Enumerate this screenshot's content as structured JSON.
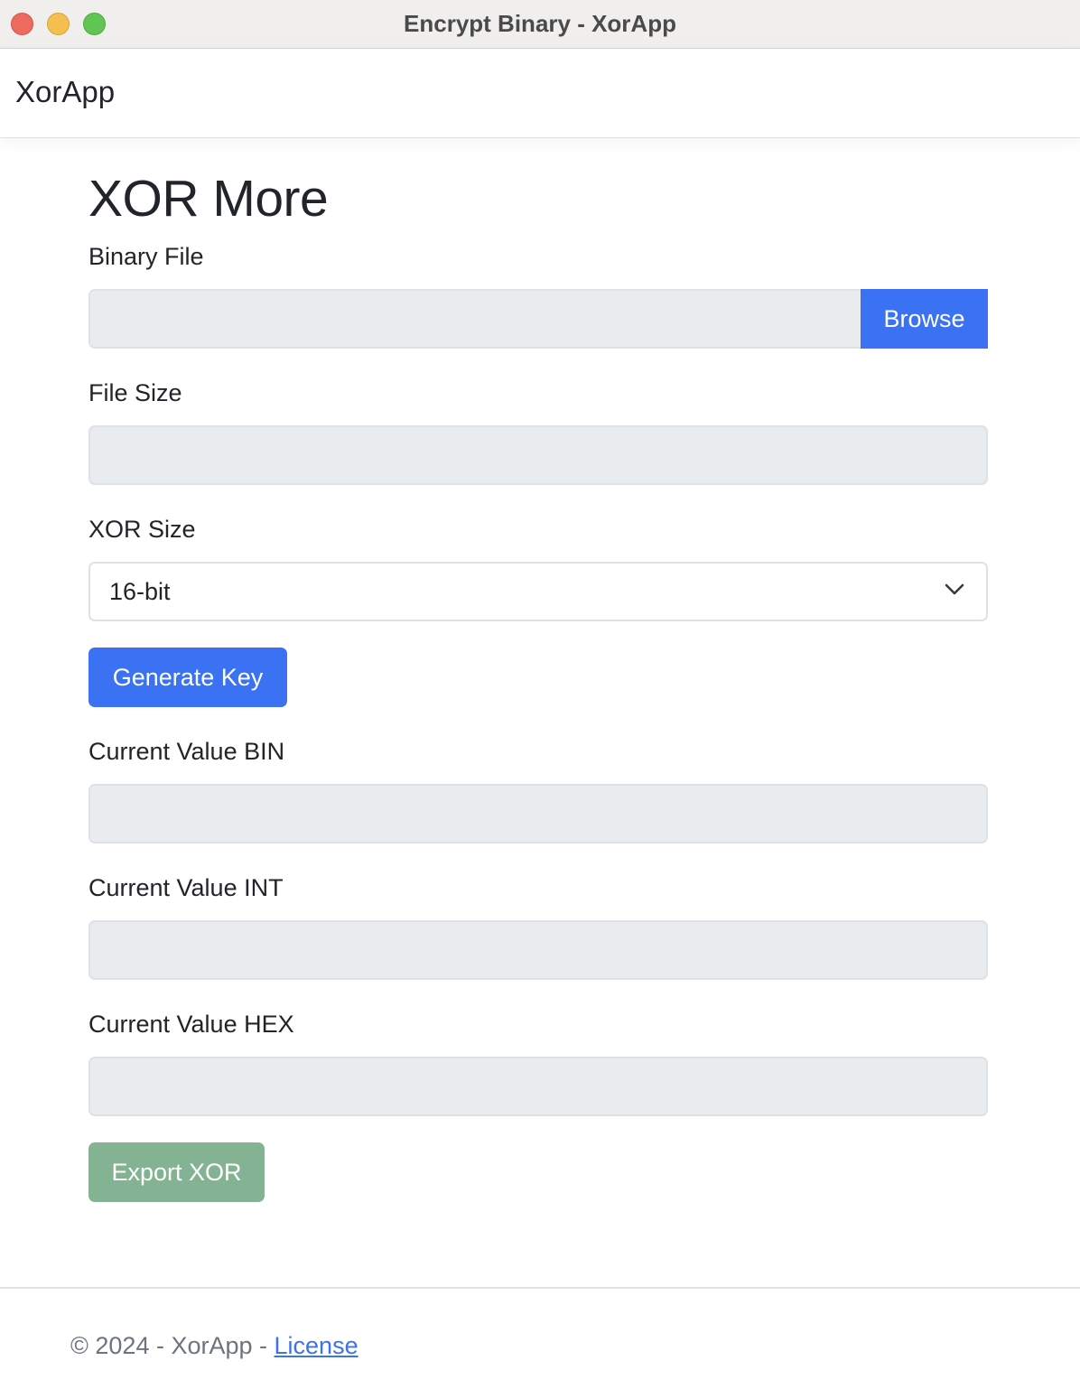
{
  "window": {
    "title": "Encrypt Binary - XorApp"
  },
  "navbar": {
    "brand": "XorApp"
  },
  "main": {
    "heading": "XOR More",
    "binary_file": {
      "label": "Binary File",
      "value": "",
      "browse_label": "Browse"
    },
    "file_size": {
      "label": "File Size",
      "value": ""
    },
    "xor_size": {
      "label": "XOR Size",
      "selected": "16-bit"
    },
    "generate_key_label": "Generate Key",
    "current_bin": {
      "label": "Current Value BIN",
      "value": ""
    },
    "current_int": {
      "label": "Current Value INT",
      "value": ""
    },
    "current_hex": {
      "label": "Current Value HEX",
      "value": ""
    },
    "export_label": "Export XOR"
  },
  "footer": {
    "text": "© 2024 - XorApp - ",
    "link_label": "License"
  },
  "colors": {
    "primary": "#3b71f3",
    "success_disabled": "#84b394",
    "readonly_bg": "#e9ecef"
  },
  "icons": {
    "select_arrow": "chevron-down-icon"
  }
}
